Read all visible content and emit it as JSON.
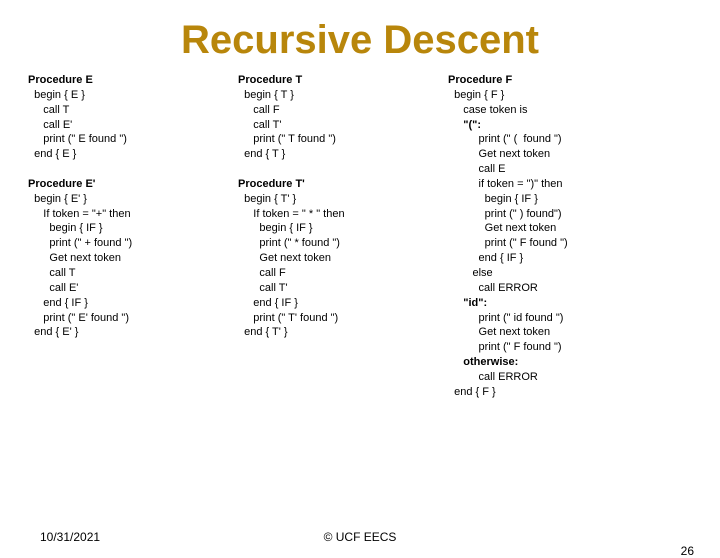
{
  "title": "Recursive Descent",
  "col1": {
    "pE_h": "Procedure E",
    "pE_l1": "  begin { E }",
    "pE_l2": "     call T",
    "pE_l3": "     call E'",
    "pE_l4": "     print (\" E found \")",
    "pE_l5": "  end { E }",
    "pEp_h": "Procedure E'",
    "pEp_l1": "  begin { E' }",
    "pEp_l2": "     If token = \"+\" then",
    "pEp_l3": "       begin { IF }",
    "pEp_l4": "       print (\" + found \")",
    "pEp_l5": "       Get next token",
    "pEp_l6": "       call T",
    "pEp_l7": "       call E'",
    "pEp_l8": "     end { IF }",
    "pEp_l9": "     print (\" E' found \")",
    "pEp_l10": "  end { E' }"
  },
  "col2": {
    "pT_h": "Procedure T",
    "pT_l1": "  begin { T }",
    "pT_l2": "     call F",
    "pT_l3": "     call T'",
    "pT_l4": "     print (\" T found \")",
    "pT_l5": "  end { T }",
    "pTp_h": "Procedure T'",
    "pTp_l1": "  begin { T' }",
    "pTp_l2": "     If token = \" * \" then",
    "pTp_l3": "       begin { IF }",
    "pTp_l4": "       print (\" * found \")",
    "pTp_l5": "       Get next token",
    "pTp_l6": "       call F",
    "pTp_l7": "       call T'",
    "pTp_l8": "     end { IF }",
    "pTp_l9": "     print (\" T' found \")",
    "pTp_l10": "  end { T' }"
  },
  "col3": {
    "pF_h": "Procedure F",
    "pF_l1": "  begin { F }",
    "pF_l2": "     case token is",
    "pF_case1": "     \"(\":",
    "pF_l3": "          print (\" (  found \")",
    "pF_l4": "          Get next token",
    "pF_l5": "          call E",
    "pF_l6": "          if token = \")\" then",
    "pF_l7": "            begin { IF }",
    "pF_l8": "            print (\" ) found\")",
    "pF_l9": "            Get next token",
    "pF_l10": "            print (\" F found \")",
    "pF_l11": "          end { IF }",
    "pF_l12": "        else",
    "pF_l13": "          call ERROR",
    "pF_case2": "     \"id\":",
    "pF_l14": "          print (\" id found \")",
    "pF_l15": "          Get next token",
    "pF_l16": "          print (\" F found \")",
    "pF_case3": "     otherwise:",
    "pF_l17": "          call ERROR",
    "pF_l18": "  end { F }"
  },
  "footer": {
    "date": "10/31/2021",
    "center": "© UCF EECS",
    "page": "26"
  }
}
